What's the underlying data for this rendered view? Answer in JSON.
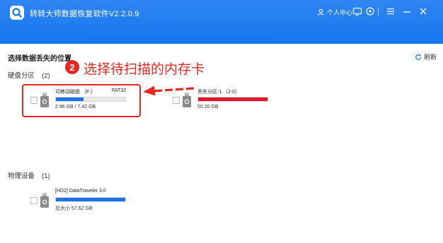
{
  "app": {
    "title": "转转大师数据恢复软件V2.2.0.9",
    "user_center_label": "个人中心"
  },
  "section": {
    "title": "选择数据丢失的位置",
    "refresh_label": "刷新"
  },
  "groups": {
    "disk_partitions": {
      "label": "硬盘分区",
      "count": "(2)"
    },
    "physical_devices": {
      "label": "物理设备",
      "count": "(1)"
    }
  },
  "drives": {
    "removable": {
      "name": "可移动磁盘 （F:）",
      "fs": "FAT32",
      "size": "2.96 GB / 7.42 GB",
      "used_fraction": 0.4,
      "bar_color": "#1a73e8",
      "checked": false
    },
    "lost_partition": {
      "name": "丢失分区-1 （2:0）",
      "size": "50.20 GB",
      "used_fraction": 1.0,
      "bar_color": "#e0142b",
      "checked": false
    },
    "datatraveler": {
      "name": "[HD2] DataTraveler 3.0",
      "size": "总大小 57.62 GB",
      "used_fraction": 1.0,
      "bar_color": "#1a73e8",
      "checked": false
    }
  },
  "annotation": {
    "step_number": "2",
    "text": "选择待扫描的内存卡",
    "color": "#e32922"
  },
  "icons": {
    "logo": "search-logo-icon",
    "user": "user-icon",
    "message": "message-icon",
    "menu": "menu-icon",
    "minimize": "minimize-icon",
    "close": "close-icon",
    "refresh": "refresh-icon",
    "drive": "usb-drive-icon"
  }
}
